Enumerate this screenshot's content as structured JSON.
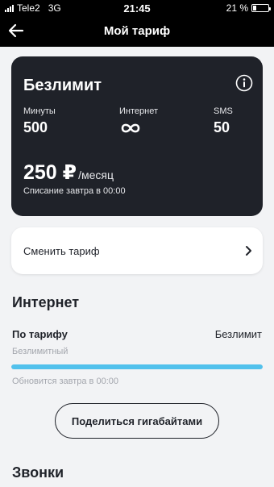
{
  "status_bar": {
    "carrier": "Tele2",
    "network": "3G",
    "time": "21:45",
    "battery": "21 %",
    "battery_level": 0.21
  },
  "nav": {
    "title": "Мой тариф",
    "back_icon": "arrow-left-icon"
  },
  "tariff": {
    "name": "Безлимит",
    "info_icon": "info-icon",
    "minutes_label": "Минуты",
    "minutes_value": "500",
    "internet_label": "Интернет",
    "internet_icon": "infinity-icon",
    "sms_label": "SMS",
    "sms_value": "50",
    "price": "250 ₽",
    "price_unit": "/месяц",
    "charge_note": "Списание завтра в 00:00"
  },
  "change_tariff": {
    "label": "Сменить тариф",
    "chevron_icon": "chevron-right-icon"
  },
  "internet": {
    "section_title": "Интернет",
    "plan_label": "По тарифу",
    "plan_value": "Безлимит",
    "plan_sub": "Безлимитный",
    "usage_fraction": 1.0,
    "renew_note": "Обновится завтра в 00:00",
    "share_button": "Поделиться гигабайтами"
  },
  "calls": {
    "section_title": "Звонки"
  },
  "colors": {
    "header_bg": "#000000",
    "card_bg": "#1f2229",
    "page_bg": "#f2f3f5",
    "progress": "#52c1ec"
  }
}
